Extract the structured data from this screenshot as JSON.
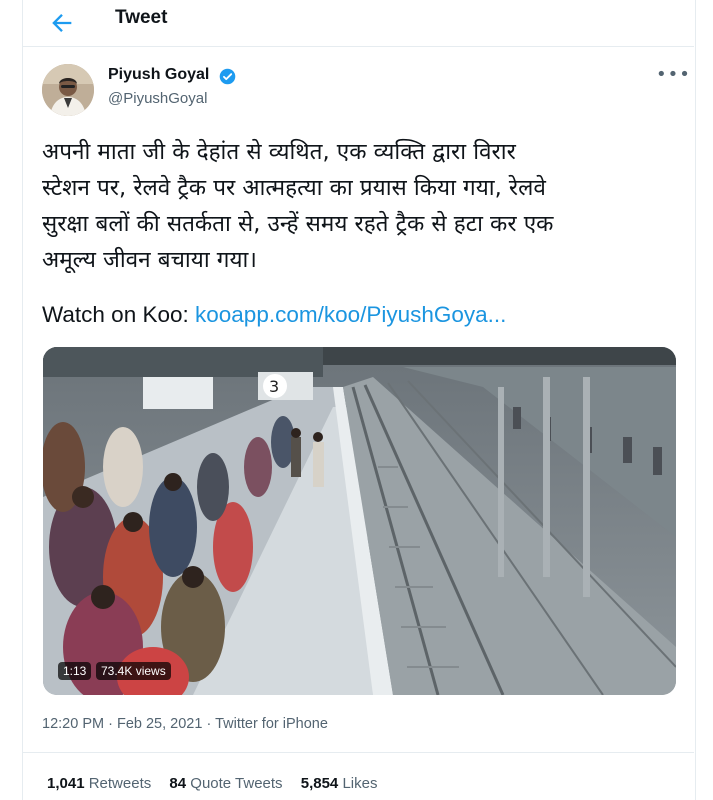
{
  "header": {
    "title": "Tweet"
  },
  "author": {
    "name": "Piyush Goyal",
    "handle": "@PiyushGoyal"
  },
  "tweet": {
    "lines": [
      "अपनी माता जी के देहांत से व्यथित, एक व्यक्ति द्वारा विरार",
      "स्टेशन पर, रेलवे ट्रैक पर आत्महत्या का प्रयास किया गया, रेलवे",
      "सुरक्षा बलों की सतर्कता से, उन्हें समय रहते ट्रैक से हटा कर एक",
      "अमूल्य जीवन बचाया गया।"
    ],
    "watch_prefix": "Watch on Koo:",
    "link": "kooapp.com/koo/PiyushGoya..."
  },
  "media": {
    "duration": "1:13",
    "views": "73.4K views",
    "platform_sign": "3"
  },
  "meta": {
    "time": "12:20 PM",
    "date": "Feb 25, 2021",
    "source": "Twitter for iPhone"
  },
  "stats": {
    "retweets_count": "1,041",
    "retweets_label": "Retweets",
    "quotes_count": "84",
    "quotes_label": "Quote Tweets",
    "likes_count": "5,854",
    "likes_label": "Likes"
  },
  "colors": {
    "accent": "#1d9bf0",
    "link": "#1b95e0",
    "muted": "#536471"
  }
}
